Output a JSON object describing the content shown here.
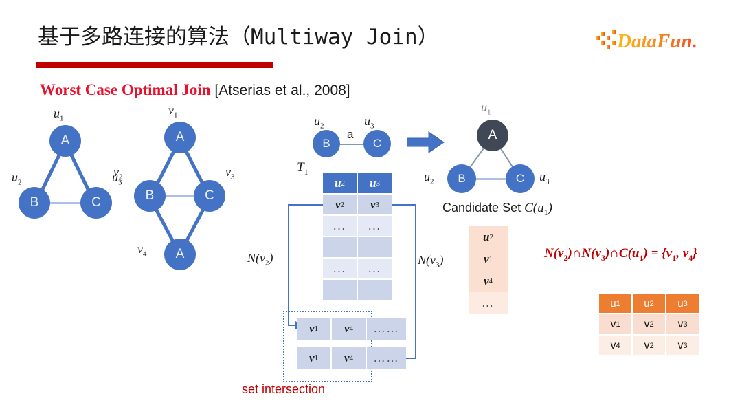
{
  "header": {
    "title": "基于多路连接的算法（Multiway Join）",
    "logo_text": "DataFun.",
    "logo_colors": {
      "start": "#FDB913",
      "mid": "#F7901E",
      "end": "#F04E23"
    },
    "rule_color": "#C00000"
  },
  "subtitle": {
    "highlight": "Worst Case Optimal Join",
    "citation": " [Atserias et al., 2008]",
    "highlight_color": "#E8112D"
  },
  "query_graph": {
    "caption": "",
    "nodes": [
      {
        "id": "A",
        "label": "A",
        "var": "u",
        "sub": "1"
      },
      {
        "id": "B",
        "label": "B",
        "var": "u",
        "sub": "2"
      },
      {
        "id": "C",
        "label": "C",
        "var": "u",
        "sub": "3"
      }
    ],
    "edges": [
      [
        "A",
        "B"
      ],
      [
        "A",
        "C"
      ],
      [
        "B",
        "C"
      ]
    ]
  },
  "data_graph": {
    "nodes": [
      {
        "id": "v1",
        "label": "A",
        "var": "v",
        "sub": "1"
      },
      {
        "id": "v2",
        "label": "B",
        "var": "v",
        "sub": "2"
      },
      {
        "id": "v3",
        "label": "C",
        "var": "v",
        "sub": "3"
      },
      {
        "id": "v4",
        "label": "A",
        "var": "v",
        "sub": "4"
      }
    ],
    "edges": [
      [
        "v1",
        "v2"
      ],
      [
        "v1",
        "v3"
      ],
      [
        "v2",
        "v3"
      ],
      [
        "v2",
        "v4"
      ],
      [
        "v3",
        "v4"
      ]
    ]
  },
  "edge_pattern": {
    "left_node": "B",
    "right_node": "C",
    "left_var": "u",
    "left_sub": "2",
    "right_var": "u",
    "right_sub": "3",
    "edge_label": "a"
  },
  "t1": {
    "name": "T",
    "name_sub": "1",
    "columns": [
      {
        "var": "u",
        "sub": "2"
      },
      {
        "var": "u",
        "sub": "3"
      }
    ],
    "rows": [
      [
        {
          "var": "v",
          "sub": "2"
        },
        {
          "var": "v",
          "sub": "3"
        }
      ],
      [
        {
          "text": "..."
        },
        {
          "text": "..."
        }
      ],
      [
        {
          "text": ""
        },
        {
          "text": ""
        }
      ],
      [
        {
          "text": "..."
        },
        {
          "text": "..."
        }
      ],
      [
        {
          "text": ""
        },
        {
          "text": ""
        }
      ]
    ]
  },
  "neighbor_labels": {
    "left": {
      "fn": "N",
      "var": "v",
      "sub": "2"
    },
    "right": {
      "fn": "N",
      "var": "v",
      "sub": "3"
    }
  },
  "intersection_rows": [
    [
      {
        "var": "v",
        "sub": "1"
      },
      {
        "var": "v",
        "sub": "4"
      },
      {
        "text": "……"
      }
    ],
    [
      {
        "var": "v",
        "sub": "1"
      },
      {
        "var": "v",
        "sub": "4"
      },
      {
        "text": "……"
      }
    ]
  ],
  "set_intersection_label": "set intersection",
  "matched_graph": {
    "nodes": [
      {
        "id": "A",
        "label": "A",
        "var": "u",
        "sub": "1",
        "style": "dark"
      },
      {
        "id": "B",
        "label": "B",
        "var": "u",
        "sub": "2",
        "style": "blue"
      },
      {
        "id": "C",
        "label": "C",
        "var": "u",
        "sub": "3",
        "style": "blue"
      }
    ]
  },
  "candidate_set": {
    "title_plain": "Candidate Set ",
    "title_fn": "C",
    "title_var": "u",
    "title_sub": "1",
    "header": {
      "var": "u",
      "sub": "2"
    },
    "rows": [
      {
        "var": "v",
        "sub": "1"
      },
      {
        "var": "v",
        "sub": "4"
      },
      {
        "text": "…"
      }
    ]
  },
  "formula": {
    "text": "N(v₂)∩N(v₃)∩C(u₁) = {v₁, v₄}",
    "parts": {
      "n1": "N",
      "n1v": "v",
      "n1s": "2",
      "cap1": "∩",
      "n2": "N",
      "n2v": "v",
      "n2s": "3",
      "cap2": "∩",
      "c": "C",
      "cv": "u",
      "cs": "1",
      "eq": " = ",
      "res_open": "{",
      "r1v": "v",
      "r1s": "1",
      "comma": ", ",
      "r2v": "v",
      "r2s": "4",
      "res_close": "}"
    },
    "color": "#C00000"
  },
  "result_table": {
    "columns": [
      {
        "var": "u",
        "sub": "1"
      },
      {
        "var": "u",
        "sub": "2"
      },
      {
        "var": "u",
        "sub": "3"
      }
    ],
    "rows": [
      [
        {
          "var": "v",
          "sub": "1"
        },
        {
          "var": "v",
          "sub": "2"
        },
        {
          "var": "v",
          "sub": "3"
        }
      ],
      [
        {
          "var": "v",
          "sub": "4"
        },
        {
          "var": "v",
          "sub": "2"
        },
        {
          "var": "v",
          "sub": "3"
        }
      ]
    ],
    "header_color": "#ED7D31"
  },
  "colors": {
    "node_blue": "#4472C4",
    "node_dark": "#404855",
    "table_head_blue": "#4472C4",
    "table_row_blue": "#CCD4E9",
    "candidate_peach": "#FBE0D2"
  }
}
